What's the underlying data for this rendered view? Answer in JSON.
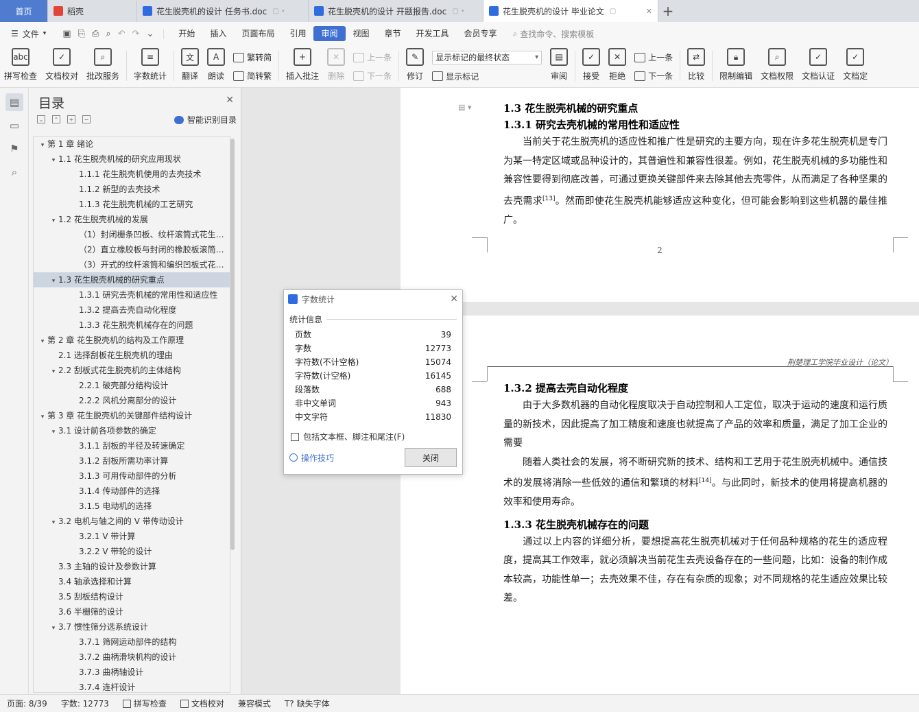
{
  "tabs": [
    {
      "label": "首页",
      "kind": "home"
    },
    {
      "label": "稻壳",
      "kind": "docer"
    },
    {
      "label": "花生脱壳机的设计 任务书.doc",
      "kind": "doc"
    },
    {
      "label": "花生脱壳机的设计 开题报告.doc",
      "kind": "doc"
    },
    {
      "label": "花生脱壳机的设计 毕业论文",
      "kind": "doc",
      "active": true
    }
  ],
  "menubar": {
    "file": "文件",
    "items": [
      "开始",
      "插入",
      "页面布局",
      "引用",
      "审阅",
      "视图",
      "章节",
      "开发工具",
      "会员专享"
    ],
    "active": "审阅",
    "search": "查找命令、搜索模板"
  },
  "ribbon": {
    "spellcheck": "拼写检查",
    "doc_proof": "文档校对",
    "batch_service": "批改服务",
    "word_count": "字数统计",
    "translate": "翻译",
    "read_aloud": "朗读",
    "trad_to_simp": "繁转简",
    "simp_to_trad": "简转繁",
    "insert_comment": "插入批注",
    "delete": "删除",
    "prev_comment": "上一条",
    "next_comment": "下一条",
    "track_changes": "修订",
    "markup_select": "显示标记的最终状态",
    "show_markup": "显示标记",
    "review": "审阅",
    "accept": "接受",
    "reject": "拒绝",
    "prev_change": "上一条",
    "next_change": "下一条",
    "compare": "比较",
    "restrict_edit": "限制编辑",
    "doc_permission": "文档权限",
    "doc_auth": "文档认证",
    "doc_final": "文档定"
  },
  "toc": {
    "title": "目录",
    "smart": "智能识别目录",
    "items": [
      {
        "text": "第 1 章  绪论",
        "level": 1,
        "arrow": true
      },
      {
        "text": "1.1  花生脱壳机械的研究应用现状",
        "level": 2,
        "arrow": true
      },
      {
        "text": "1.1.1  花生脱壳机使用的去壳技术",
        "level": 3
      },
      {
        "text": "1.1.2  新型的去壳技术",
        "level": 3
      },
      {
        "text": "1.1.3  花生脱壳机械的工艺研究",
        "level": 3
      },
      {
        "text": "1.2  花生脱壳机械的发展",
        "level": 2,
        "arrow": true
      },
      {
        "text": "（1）封闭栅条凹板、纹杆滚筒式花生…",
        "level": 3
      },
      {
        "text": "（2）直立橡胶板与封闭的橡胶板滚筒…",
        "level": 3
      },
      {
        "text": "（3）开式的纹杆滚筒和编织凹板式花…",
        "level": 3
      },
      {
        "text": "1.3  花生脱壳机械的研究重点",
        "level": 2,
        "arrow": true,
        "selected": true
      },
      {
        "text": "1.3.1  研究去壳机械的常用性和适应性",
        "level": 3
      },
      {
        "text": "1.3.2  提高去壳自动化程度",
        "level": 3
      },
      {
        "text": "1.3.3  花生脱壳机械存在的问题",
        "level": 3
      },
      {
        "text": "第 2 章  花生脱壳机的结构及工作原理",
        "level": 1,
        "arrow": true
      },
      {
        "text": "2.1  选择刮板花生脱壳机的理由",
        "level": 2
      },
      {
        "text": "2.2  刮板式花生脱壳机的主体结构",
        "level": 2,
        "arrow": true
      },
      {
        "text": "2.2.1  破壳部分结构设计",
        "level": 3
      },
      {
        "text": "2.2.2  风机分离部分的设计",
        "level": 3
      },
      {
        "text": "第 3 章  花生脱壳机的关键部件结构设计",
        "level": 1,
        "arrow": true
      },
      {
        "text": "3.1  设计前各项参数的确定",
        "level": 2,
        "arrow": true
      },
      {
        "text": "3.1.1  刮板的半径及转速确定",
        "level": 3
      },
      {
        "text": "3.1.2  刮板所需功率计算",
        "level": 3
      },
      {
        "text": "3.1.3  可用传动部件的分析",
        "level": 3
      },
      {
        "text": "3.1.4  传动部件的选择",
        "level": 3
      },
      {
        "text": "3.1.5  电动机的选择",
        "level": 3
      },
      {
        "text": "3.2  电机与轴之间的 V 带传动设计",
        "level": 2,
        "arrow": true
      },
      {
        "text": "3.2.1 V 带计算",
        "level": 3
      },
      {
        "text": "3.2.2 V 带轮的设计",
        "level": 3
      },
      {
        "text": "3.3  主轴的设计及参数计算",
        "level": 2
      },
      {
        "text": "3.4  轴承选择和计算",
        "level": 2
      },
      {
        "text": "3.5  刮板结构设计",
        "level": 2
      },
      {
        "text": "3.6  半栅筛的设计",
        "level": 2
      },
      {
        "text": "3.7  惯性筛分选系统设计",
        "level": 2,
        "arrow": true
      },
      {
        "text": "3.7.1  筛网运动部件的结构",
        "level": 3
      },
      {
        "text": "3.7.2  曲柄滑块机构的设计",
        "level": 3
      },
      {
        "text": "3.7.3  曲柄轴设计",
        "level": 3
      },
      {
        "text": "3.7.4  连杆设计",
        "level": 3
      }
    ]
  },
  "document": {
    "page1": {
      "h_13": "1.3  花生脱壳机械的研究重点",
      "h_131": "1.3.1  研究去壳机械的常用性和适应性",
      "p1": "当前关于花生脱壳机的适应性和推广性是研究的主要方向，现在许多花生脱壳机是专门为某一特定区域或品种设计的，其普遍性和兼容性很差。例如，花生脱壳机械的多功能性和兼容性要得到彻底改善，可通过更换关键部件来去除其他去壳零件，从而满足了各种坚果的去壳需求",
      "p1_ref": "[13]",
      "p1_tail": "。然而即使花生脱壳机能够适应这种变化，但可能会影响到这些机器的最佳推广。",
      "page_number": "2"
    },
    "page2": {
      "header": "荆楚理工学院毕业设计（论文）",
      "h_132": "1.3.2  提高去壳自动化程度",
      "p1": "由于大多数机器的自动化程度取决于自动控制和人工定位，取决于运动的速度和运行质量的新技术，因此提高了加工精度和速度也就提高了产品的效率和质量，满足了加工企业的需要",
      "p2": "随着人类社会的发展，将不断研究新的技术、结构和工艺用于花生脱壳机械中。通信技术的发展将消除一些低效的通信和繁琐的材料",
      "p2_ref": "[14]",
      "p2_tail": "。与此同时，新技术的使用将提高机器的效率和使用寿命。",
      "h_133": "1.3.3  花生脱壳机械存在的问题",
      "p3": "通过以上内容的详细分析，要想提高花生脱壳机械对于任何品种规格的花生的适应程度，提高其工作效率，就必须解决当前花生去壳设备存在的一些问题，比如：设备的制作成本较高，功能性单一；去壳效果不佳，存在有杂质的现象；对不同规格的花生适应效果比较差。"
    }
  },
  "dialog": {
    "title": "字数统计",
    "section": "统计信息",
    "rows": [
      {
        "label": "页数",
        "value": "39"
      },
      {
        "label": "字数",
        "value": "12773"
      },
      {
        "label": "字符数(不计空格)",
        "value": "15074"
      },
      {
        "label": "字符数(计空格)",
        "value": "16145"
      },
      {
        "label": "段落数",
        "value": "688"
      },
      {
        "label": "非中文单词",
        "value": "943"
      },
      {
        "label": "中文字符",
        "value": "11830"
      }
    ],
    "checkbox": "包括文本框、脚注和尾注(F)",
    "tips": "操作技巧",
    "close": "关闭"
  },
  "status": {
    "page": "页面: 8/39",
    "words": "字数: 12773",
    "spell": "拼写检查",
    "proof": "文档校对",
    "compat": "兼容模式",
    "missing_font": "缺失字体"
  }
}
